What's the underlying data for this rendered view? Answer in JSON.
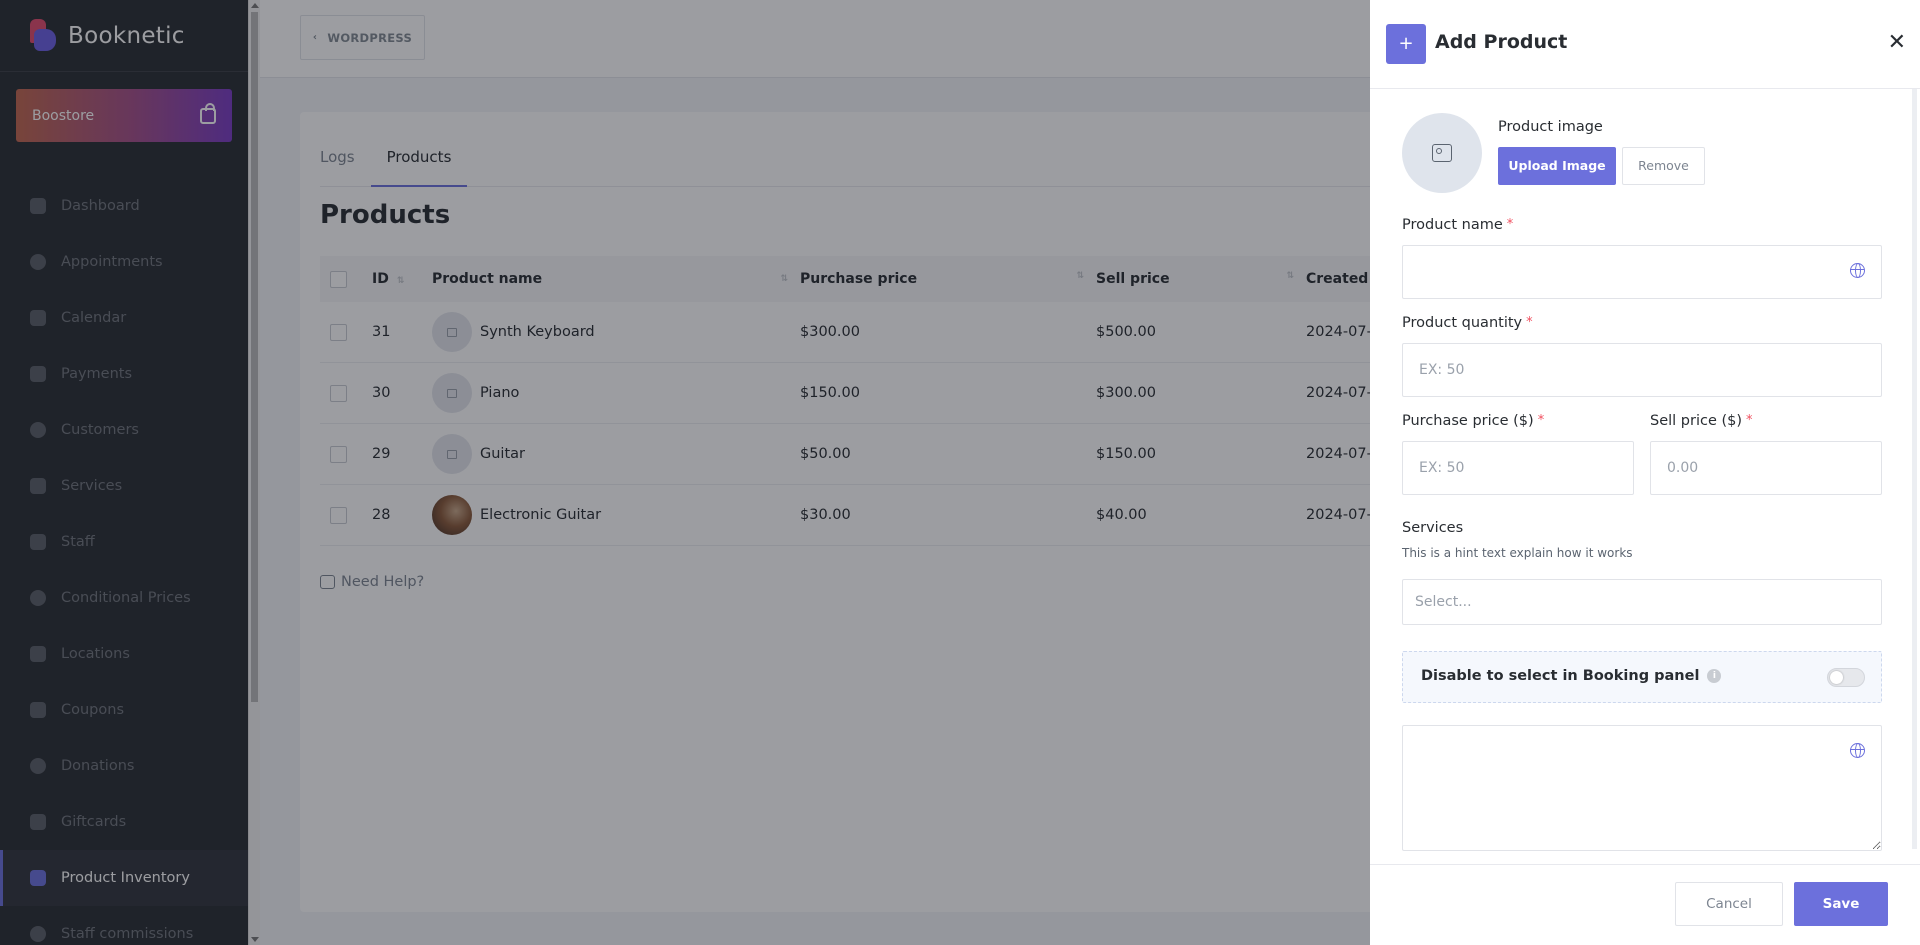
{
  "app": {
    "name": "Booknetic"
  },
  "sidebar": {
    "boostore_label": "Boostore",
    "items": [
      {
        "label": "Dashboard",
        "icon": "dashboard-icon"
      },
      {
        "label": "Appointments",
        "icon": "clock-icon"
      },
      {
        "label": "Calendar",
        "icon": "calendar-icon"
      },
      {
        "label": "Payments",
        "icon": "credit-card-icon"
      },
      {
        "label": "Customers",
        "icon": "users-icon"
      },
      {
        "label": "Services",
        "icon": "list-icon"
      },
      {
        "label": "Staff",
        "icon": "user-icon"
      },
      {
        "label": "Conditional Prices",
        "icon": "text-cursor-icon"
      },
      {
        "label": "Locations",
        "icon": "location-arrow-icon"
      },
      {
        "label": "Coupons",
        "icon": "tag-icon"
      },
      {
        "label": "Donations",
        "icon": "hand-heart-icon"
      },
      {
        "label": "Giftcards",
        "icon": "gift-icon"
      },
      {
        "label": "Product Inventory",
        "icon": "magic-wand-icon",
        "active": true
      },
      {
        "label": "Staff commissions",
        "icon": "handshake-icon"
      }
    ]
  },
  "header": {
    "wordpress_label": "WORDPRESS"
  },
  "main": {
    "tabs": [
      {
        "label": "Logs"
      },
      {
        "label": "Products",
        "active": true
      }
    ],
    "title": "Products",
    "table": {
      "columns": [
        "ID",
        "Product name",
        "Purchase price",
        "Sell price",
        "Created"
      ],
      "rows": [
        {
          "id": "31",
          "name": "Synth Keyboard",
          "purchase": "$300.00",
          "sell": "$500.00",
          "created": "2024-07-"
        },
        {
          "id": "30",
          "name": "Piano",
          "purchase": "$150.00",
          "sell": "$300.00",
          "created": "2024-07-"
        },
        {
          "id": "29",
          "name": "Guitar",
          "purchase": "$50.00",
          "sell": "$150.00",
          "created": "2024-07-"
        },
        {
          "id": "28",
          "name": "Electronic Guitar",
          "purchase": "$30.00",
          "sell": "$40.00",
          "created": "2024-07-"
        }
      ]
    },
    "help_label": "Need Help?"
  },
  "modal": {
    "title": "Add Product",
    "plus": "+",
    "close": "✕",
    "product_image_label": "Product image",
    "upload_label": "Upload Image",
    "remove_label": "Remove",
    "product_name_label": "Product name",
    "product_quantity_label": "Product quantity",
    "quantity_placeholder": "EX: 50",
    "purchase_price_label": "Purchase price ($)",
    "purchase_placeholder": "EX: 50",
    "sell_price_label": "Sell price ($)",
    "sell_placeholder": "0.00",
    "services_label": "Services",
    "services_hint": "This is a hint text explain how it works",
    "services_placeholder": "Select...",
    "disable_label": "Disable to select in Booking panel",
    "disable_enabled": false,
    "cancel_label": "Cancel",
    "save_label": "Save",
    "required_mark": "*"
  },
  "colors": {
    "accent": "#6c70dc",
    "sidebar_bg": "#292d32",
    "required": "#f04e5e"
  }
}
